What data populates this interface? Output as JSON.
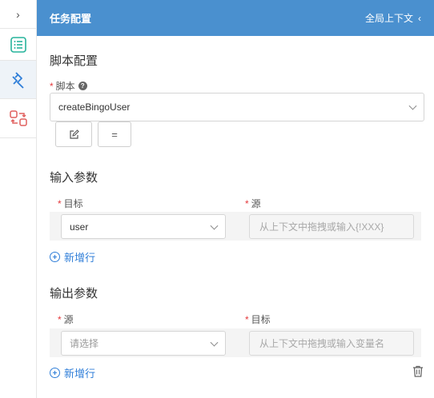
{
  "header": {
    "title": "任务配置",
    "context_link": "全局上下文",
    "context_chevron": "‹"
  },
  "rail": {
    "toggle": "›"
  },
  "script_config": {
    "title": "脚本配置",
    "script_label": "脚本",
    "script_value": "createBingoUser",
    "equals_button": "="
  },
  "input_params": {
    "title": "输入参数",
    "col_target": "目标",
    "col_source": "源",
    "rows": [
      {
        "target": "user",
        "source_placeholder": "从上下文中拖拽或输入{!XXX}"
      }
    ],
    "add_row": "新增行"
  },
  "output_params": {
    "title": "输出参数",
    "col_source": "源",
    "col_target": "目标",
    "rows": [
      {
        "source_placeholder": "请选择",
        "target_placeholder": "从上下文中拖拽或输入变量名"
      }
    ],
    "add_row": "新增行"
  },
  "colors": {
    "header_bg": "#4a90cf",
    "accent": "#2f7ed8",
    "required": "#e4393c",
    "icon_teal": "#27b39b",
    "icon_blue": "#2f7ed8",
    "icon_red": "#e0605f"
  }
}
